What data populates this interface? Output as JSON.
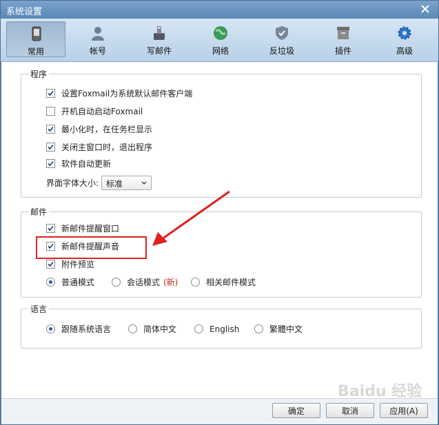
{
  "window": {
    "title": "系统设置"
  },
  "tabs": [
    {
      "label": "常用",
      "icon": "phone-icon",
      "active": true
    },
    {
      "label": "帐号",
      "icon": "user-icon",
      "active": false
    },
    {
      "label": "写邮件",
      "icon": "write-mail-icon",
      "active": false
    },
    {
      "label": "网络",
      "icon": "globe-icon",
      "active": false
    },
    {
      "label": "反垃圾",
      "icon": "shield-icon",
      "active": false
    },
    {
      "label": "插件",
      "icon": "plugin-box-icon",
      "active": false
    },
    {
      "label": "高级",
      "icon": "gear-icon",
      "active": false
    }
  ],
  "program": {
    "legend": "程序",
    "options": [
      {
        "label": "设置Foxmail为系统默认邮件客户端",
        "checked": true
      },
      {
        "label": "开机自动启动Foxmail",
        "checked": false
      },
      {
        "label": "最小化时，在任务栏显示",
        "checked": true
      },
      {
        "label": "关闭主窗口时，退出程序",
        "checked": true
      },
      {
        "label": "软件自动更新",
        "checked": true
      }
    ],
    "font_size_label": "界面字体大小:",
    "font_size_value": "标准"
  },
  "mail": {
    "legend": "邮件",
    "options": [
      {
        "label": "新邮件提醒窗口",
        "checked": true
      },
      {
        "label": "新邮件提醒声音",
        "checked": true
      },
      {
        "label": "附件预览",
        "checked": true
      }
    ],
    "modes": [
      {
        "label": "普通模式",
        "selected": true
      },
      {
        "label": "会话模式",
        "selected": false
      },
      {
        "label": "相关邮件模式",
        "selected": false
      }
    ],
    "new_tag": "(新)",
    "new_tag_color": "#d0281e"
  },
  "language": {
    "legend": "语言",
    "options": [
      {
        "label": "跟随系统语言",
        "selected": true
      },
      {
        "label": "简体中文",
        "selected": false
      },
      {
        "label": "English",
        "selected": false
      },
      {
        "label": "繁體中文",
        "selected": false
      }
    ]
  },
  "buttons": {
    "ok": "确定",
    "cancel": "取消",
    "apply": "应用(A)"
  },
  "annotation": {
    "color": "#e02020"
  },
  "watermark": "Baidu 经验"
}
